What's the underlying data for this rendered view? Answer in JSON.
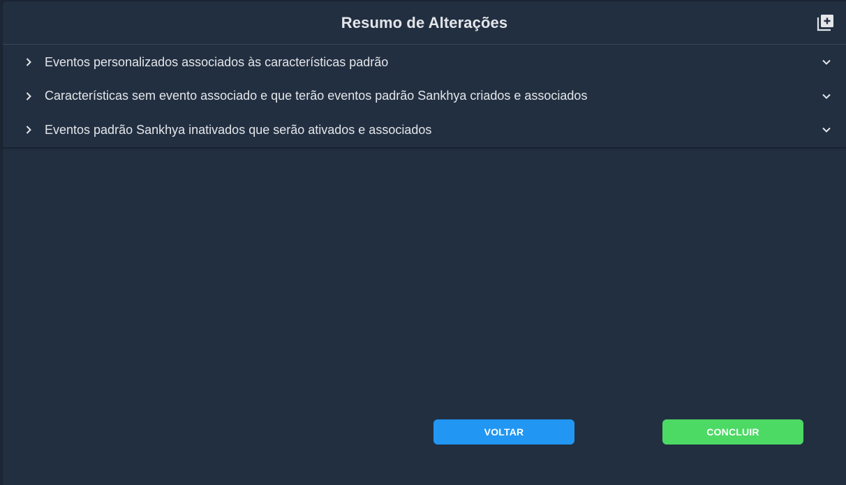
{
  "dialog": {
    "title": "Resumo de Alterações",
    "expand_icon": "add-window-icon"
  },
  "accordion": {
    "items": [
      {
        "label": "Eventos personalizados associados às características padrão",
        "expanded": false
      },
      {
        "label": "Características sem evento associado e que terão eventos padrão Sankhya criados e associados",
        "expanded": false
      },
      {
        "label": "Eventos padrão Sankhya inativados que serão ativados e associados",
        "expanded": false
      }
    ]
  },
  "footer": {
    "back_label": "VOLTAR",
    "finish_label": "CONCLUIR"
  },
  "colors": {
    "background": "#222f41",
    "text": "#e4e6ea",
    "back_button": "#2196f3",
    "finish_button": "#4cd964"
  }
}
